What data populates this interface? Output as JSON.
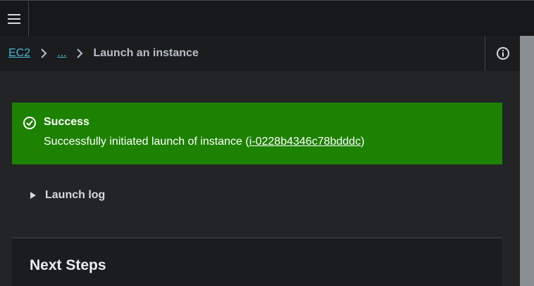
{
  "header": {
    "menu_icon": "hamburger-menu-icon"
  },
  "breadcrumb": {
    "root": "EC2",
    "ellipsis": "...",
    "current": "Launch an instance",
    "info_icon": "info-circle-icon"
  },
  "alert": {
    "type": "success",
    "icon": "check-circle-icon",
    "title": "Success",
    "message_prefix": "Successfully initiated launch of instance (",
    "instance_id": "i-0228b4346c78bdddc",
    "message_suffix": ")"
  },
  "launch_log": {
    "label": "Launch log",
    "icon": "caret-right-icon"
  },
  "next_steps": {
    "title": "Next Steps"
  },
  "colors": {
    "success_bg": "#1d8102",
    "link": "#44b9d6",
    "background": "#222426"
  }
}
